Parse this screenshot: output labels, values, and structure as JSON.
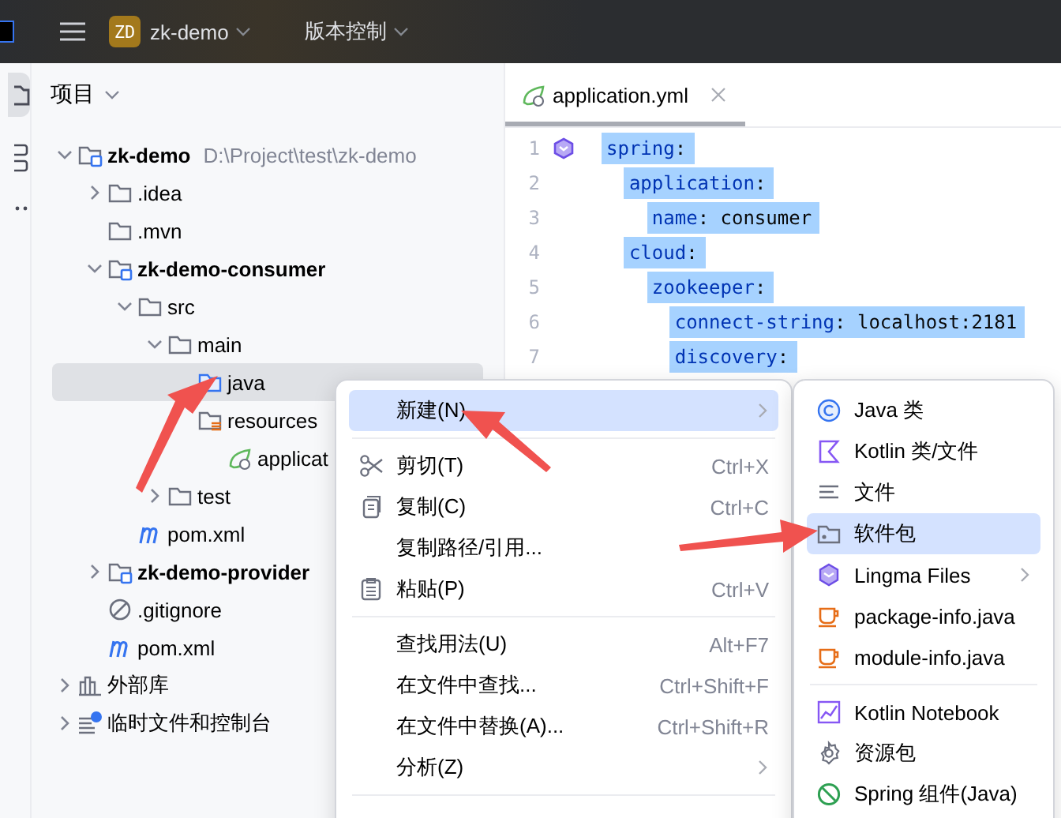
{
  "topbar": {
    "badge": "ZD",
    "project": "zk-demo",
    "vcs": "版本控制"
  },
  "project_panel": {
    "title": "项目",
    "tree": [
      {
        "name": "zk-demo",
        "path": "D:\\Project\\test\\zk-demo",
        "kind": "module",
        "expanded": true,
        "selected": false,
        "children": [
          {
            "name": ".idea",
            "kind": "folder",
            "expanded": false,
            "selected": false
          },
          {
            "name": ".mvn",
            "kind": "folder",
            "selected": false
          },
          {
            "name": "zk-demo-consumer",
            "kind": "module",
            "expanded": true,
            "selected": false,
            "children": [
              {
                "name": "src",
                "kind": "folder",
                "expanded": true,
                "selected": false,
                "children": [
                  {
                    "name": "main",
                    "kind": "folder",
                    "expanded": true,
                    "selected": false,
                    "children": [
                      {
                        "name": "java",
                        "kind": "source",
                        "selected": true
                      },
                      {
                        "name": "resources",
                        "kind": "resources",
                        "selected": false,
                        "children": [
                          {
                            "name": "applicat",
                            "kind": "spring",
                            "selected": false
                          }
                        ]
                      }
                    ]
                  },
                  {
                    "name": "test",
                    "kind": "folder",
                    "expanded": false,
                    "selected": false
                  }
                ]
              },
              {
                "name": "pom.xml",
                "kind": "maven",
                "selected": false
              }
            ]
          },
          {
            "name": "zk-demo-provider",
            "kind": "module",
            "expanded": false,
            "selected": false
          },
          {
            "name": ".gitignore",
            "kind": "ignore",
            "selected": false
          },
          {
            "name": "pom.xml",
            "kind": "maven",
            "selected": false
          }
        ]
      },
      {
        "name": "外部库",
        "kind": "library",
        "expanded": false,
        "selected": false
      },
      {
        "name": "临时文件和控制台",
        "kind": "scratch",
        "expanded": false,
        "selected": false
      }
    ]
  },
  "editor": {
    "tab": "application.yml",
    "lines": [
      {
        "number": "1",
        "text": "spring:"
      },
      {
        "number": "2",
        "text": "  application:"
      },
      {
        "number": "3",
        "text": "    name: consumer"
      },
      {
        "number": "4",
        "text": "  cloud:"
      },
      {
        "number": "5",
        "text": "    zookeeper:"
      },
      {
        "number": "6",
        "text": "      connect-string: localhost:2181"
      },
      {
        "number": "7",
        "text": "      discovery:"
      }
    ]
  },
  "context_menu": [
    {
      "kind": "item",
      "label": "新建(N)",
      "submenu": true,
      "selected": true
    },
    {
      "kind": "separator"
    },
    {
      "kind": "item",
      "label": "剪切(T)",
      "shortcut": "Ctrl+X",
      "selected": false
    },
    {
      "kind": "item",
      "label": "复制(C)",
      "shortcut": "Ctrl+C",
      "selected": false
    },
    {
      "kind": "item",
      "label": "复制路径/引用...",
      "selected": false
    },
    {
      "kind": "item",
      "label": "粘贴(P)",
      "shortcut": "Ctrl+V",
      "selected": false
    },
    {
      "kind": "separator"
    },
    {
      "kind": "item",
      "label": "查找用法(U)",
      "shortcut": "Alt+F7",
      "selected": false
    },
    {
      "kind": "item",
      "label": "在文件中查找...",
      "shortcut": "Ctrl+Shift+F",
      "selected": false
    },
    {
      "kind": "item",
      "label": "在文件中替换(A)...",
      "shortcut": "Ctrl+Shift+R",
      "selected": false
    },
    {
      "kind": "item",
      "label": "分析(Z)",
      "submenu": true,
      "selected": false
    },
    {
      "kind": "separator"
    }
  ],
  "new_submenu": [
    {
      "kind": "item",
      "label": "Java 类",
      "selected": false
    },
    {
      "kind": "item",
      "label": "Kotlin 类/文件",
      "selected": false
    },
    {
      "kind": "item",
      "label": "文件",
      "selected": false
    },
    {
      "kind": "item",
      "label": "软件包",
      "selected": true
    },
    {
      "kind": "item",
      "label": "Lingma Files",
      "submenu": true,
      "selected": false
    },
    {
      "kind": "item",
      "label": "package-info.java",
      "selected": false
    },
    {
      "kind": "item",
      "label": "module-info.java",
      "selected": false
    },
    {
      "kind": "separator"
    },
    {
      "kind": "item",
      "label": "Kotlin Notebook",
      "selected": false
    },
    {
      "kind": "item",
      "label": "资源包",
      "selected": false
    },
    {
      "kind": "item",
      "label": "Spring 组件(Java)",
      "selected": false
    }
  ]
}
